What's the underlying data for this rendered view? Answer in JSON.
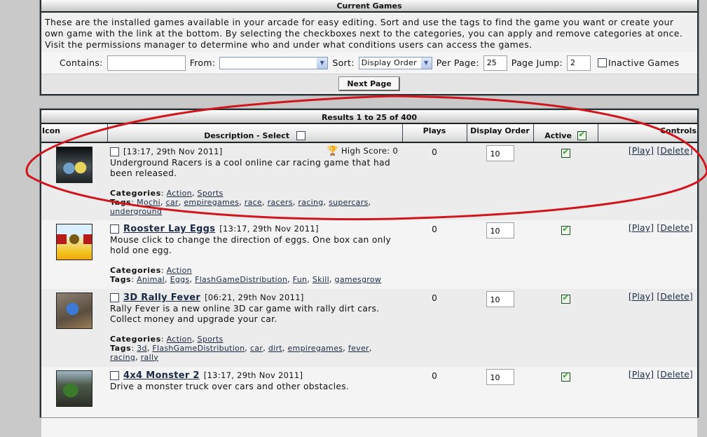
{
  "top_panel": {
    "title": "Current Games",
    "intro": "These are the installed games available in your arcade for easy editing. Sort and use the tags to find the game you want or create your own game with the link at the bottom. By selecting the checkboxes next to the categories, you can apply and remove categories at once. Visit the permissions manager to determine who and under what conditions users can access the games.",
    "filters": {
      "contains_label": "Contains:",
      "contains_value": "",
      "from_label": "From:",
      "from_value": "",
      "sort_label": "Sort:",
      "sort_value": "Display Order",
      "per_page_label": "Per Page:",
      "per_page_value": "25",
      "page_jump_label": "Page Jump:",
      "page_jump_value": "2",
      "inactive_label": "Inactive Games",
      "inactive_checked": false
    },
    "next_page_label": "Next Page"
  },
  "results": {
    "title": "Results 1 to 25 of 400",
    "columns": {
      "icon": "Icon",
      "description": "Description - Select",
      "plays": "Plays",
      "display_order": "Display Order",
      "active": "Active",
      "controls": "Controls"
    },
    "rows": [
      {
        "title": "",
        "date": "[13:17, 29th Nov 2011]",
        "high_score_label": "High Score: 0",
        "description": "Underground Racers is a cool online car racing game that had been released.",
        "categories_label": "Categories",
        "categories": [
          "Action",
          "Sports"
        ],
        "tags_label": "Tags",
        "tags": [
          "Mochi",
          "car",
          "empiregames",
          "race",
          "racers",
          "racing",
          "supercars",
          "underground"
        ],
        "plays": "0",
        "display_order": "10",
        "active": true,
        "play_label": "[Play]",
        "delete_label": "[Delete]"
      },
      {
        "title": "Rooster Lay Eggs",
        "date": "[13:17, 29th Nov 2011]",
        "description": "Mouse click to change the direction of eggs. One box can only hold one egg.",
        "categories_label": "Categories",
        "categories": [
          "Action"
        ],
        "tags_label": "Tags",
        "tags": [
          "Animal",
          "Eggs",
          "FlashGameDistribution",
          "Fun",
          "Skill",
          "gamesgrow"
        ],
        "plays": "0",
        "display_order": "10",
        "active": true,
        "play_label": "[Play]",
        "delete_label": "[Delete]"
      },
      {
        "title": "3D Rally Fever",
        "date": "[06:21, 29th Nov 2011]",
        "description": "Rally Fever is a new online 3D car game with rally dirt cars. Collect money and upgrade your car.",
        "categories_label": "Categories",
        "categories": [
          "Action",
          "Sports"
        ],
        "tags_label": "Tags",
        "tags": [
          "3d",
          "FlashGameDistribution",
          "car",
          "dirt",
          "empiregames",
          "fever",
          "racing",
          "rally"
        ],
        "plays": "0",
        "display_order": "10",
        "active": true,
        "play_label": "[Play]",
        "delete_label": "[Delete]"
      },
      {
        "title": "4x4 Monster 2",
        "date": "[13:17, 29th Nov 2011]",
        "description": "Drive a monster truck over cars and other obstacles.",
        "plays": "0",
        "display_order": "10",
        "active": true,
        "play_label": "[Play]",
        "delete_label": "[Delete]"
      }
    ]
  },
  "annotation": {
    "color": "#d0161c"
  }
}
